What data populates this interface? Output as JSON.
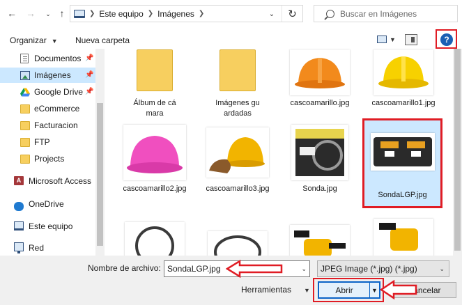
{
  "address": {
    "crumbs": [
      "Este equipo",
      "Imágenes"
    ],
    "search_placeholder": "Buscar en Imágenes"
  },
  "toolbar": {
    "organize_label": "Organizar",
    "new_folder_label": "Nueva carpeta",
    "help_label": "?"
  },
  "nav": {
    "items": [
      {
        "label": "Documentos",
        "icon": "document-icon",
        "pinned": true
      },
      {
        "label": "Imágenes",
        "icon": "pictures-icon",
        "pinned": true,
        "selected": true
      },
      {
        "label": "Google Drive",
        "icon": "google-drive-icon",
        "pinned": true
      },
      {
        "label": "eCommerce",
        "icon": "folder-icon"
      },
      {
        "label": "Facturacion",
        "icon": "folder-icon"
      },
      {
        "label": "FTP",
        "icon": "folder-icon"
      },
      {
        "label": "Projects",
        "icon": "folder-icon"
      },
      {
        "label": "Microsoft Access",
        "icon": "access-icon"
      },
      {
        "label": "OneDrive",
        "icon": "onedrive-icon"
      },
      {
        "label": "Este equipo",
        "icon": "this-pc-icon"
      },
      {
        "label": "Red",
        "icon": "network-icon"
      }
    ]
  },
  "files": [
    {
      "name": "Álbum de cámara",
      "kind": "folder"
    },
    {
      "name": "Imágenes guardadas",
      "kind": "folder"
    },
    {
      "name": "cascoamarillo.jpg",
      "kind": "image"
    },
    {
      "name": "cascoamarillo1.jpg",
      "kind": "image"
    },
    {
      "name": "cascoamarillo2.jpg",
      "kind": "image"
    },
    {
      "name": "cascoamarillo3.jpg",
      "kind": "image"
    },
    {
      "name": "Sonda.jpg",
      "kind": "image"
    },
    {
      "name": "SondaLGP.jpg",
      "kind": "image",
      "selected": true
    },
    {
      "name": "",
      "kind": "image"
    },
    {
      "name": "",
      "kind": "image"
    },
    {
      "name": "",
      "kind": "image"
    },
    {
      "name": "",
      "kind": "image"
    }
  ],
  "bottom": {
    "filename_label": "Nombre de archivo:",
    "filename_value": "SondaLGP.jpg",
    "filetype_value": "JPEG Image (*.jpg) (*.jpg)",
    "tools_label": "Herramientas",
    "open_label": "Abrir",
    "cancel_label": "Cancelar"
  },
  "colors": {
    "selection": "#cce8ff",
    "highlight_annotation": "#e01c24",
    "accent": "#0a63c7"
  }
}
